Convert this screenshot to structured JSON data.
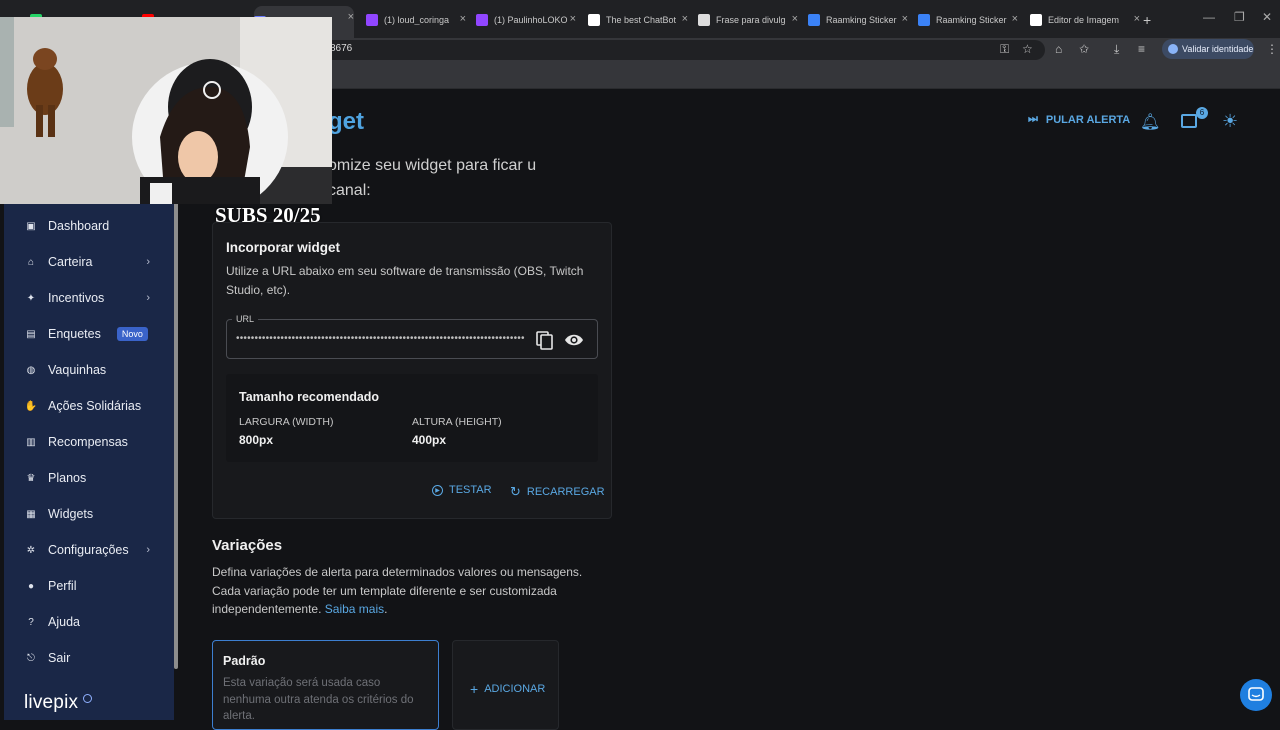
{
  "browser": {
    "tabs": [
      {
        "title": "",
        "favicon": "whatsapp-icon",
        "color": "#25d366",
        "closable": false
      },
      {
        "title": "",
        "favicon": "youtube-icon",
        "color": "#ff0000",
        "closable": false
      },
      {
        "title": "",
        "favicon": "livepix-icon",
        "color": "#6b7cff",
        "closable": true
      },
      {
        "title": "(1) loud_coringa",
        "favicon": "twitch-icon",
        "color": "#9146ff",
        "closable": true
      },
      {
        "title": "(1) PaulinhoLOKO",
        "favicon": "twitch-icon",
        "color": "#9146ff",
        "closable": true
      },
      {
        "title": "The best ChatBot",
        "favicon": "chatbot-icon",
        "color": "#ffffff",
        "closable": true
      },
      {
        "title": "Frase para divulg",
        "favicon": "openai-icon",
        "color": "#dddddd",
        "closable": true
      },
      {
        "title": "Raamking Sticker",
        "favicon": "gif-icon",
        "color": "#3b82f6",
        "closable": true
      },
      {
        "title": "Raamking Sticker",
        "favicon": "gif-icon",
        "color": "#3b82f6",
        "closable": true
      },
      {
        "title": "Editor de Imagem",
        "favicon": "photopea-icon",
        "color": "#ffffff",
        "closable": true
      }
    ],
    "new_tab": "+",
    "url_partial": "8676",
    "verify_label": "Validar identidade"
  },
  "overlay": {
    "subs_text": "SUBS 20/25"
  },
  "sidebar": {
    "items": [
      {
        "label": "Dashboard",
        "icon": "dashboard-icon",
        "glyph": "▣",
        "has_submenu": false
      },
      {
        "label": "Carteira",
        "icon": "bank-icon",
        "glyph": "⌂",
        "has_submenu": true
      },
      {
        "label": "Incentivos",
        "icon": "sparkle-icon",
        "glyph": "✦",
        "has_submenu": true
      },
      {
        "label": "Enquetes",
        "icon": "poll-icon",
        "glyph": "▤",
        "has_submenu": false,
        "badge": "Novo"
      },
      {
        "label": "Vaquinhas",
        "icon": "piggy-bank-icon",
        "glyph": "◍",
        "has_submenu": false
      },
      {
        "label": "Ações Solidárias",
        "icon": "hand-heart-icon",
        "glyph": "✋",
        "has_submenu": false
      },
      {
        "label": "Recompensas",
        "icon": "gift-icon",
        "glyph": "▥",
        "has_submenu": false
      },
      {
        "label": "Planos",
        "icon": "crown-icon",
        "glyph": "♛",
        "has_submenu": false
      },
      {
        "label": "Widgets",
        "icon": "widget-icon",
        "glyph": "▦",
        "has_submenu": false
      },
      {
        "label": "Configurações",
        "icon": "gear-icon",
        "glyph": "✲",
        "has_submenu": true
      },
      {
        "label": "Perfil",
        "icon": "user-icon",
        "glyph": "●",
        "has_submenu": false
      },
      {
        "label": "Ajuda",
        "icon": "help-icon",
        "glyph": "?",
        "has_submenu": false
      },
      {
        "label": "Sair",
        "icon": "logout-icon",
        "glyph": "⎋",
        "has_submenu": false
      }
    ],
    "logo": "livepix"
  },
  "header": {
    "title_partial": "get",
    "description": "omize seu widget para ficar u canal:",
    "skip_alert": "PULAR ALERTA",
    "notification_count": "6"
  },
  "embed": {
    "title": "Incorporar widget",
    "description": "Utilize a URL abaixo em seu software de transmissão (OBS, Twitch Studio, etc).",
    "url_label": "URL",
    "url_masked": "••••••••••••••••••••••••••••••••••••••••••••••••••••••••••••••••••••••••••••••",
    "recommended_title": "Tamanho recomendado",
    "width_label": "LARGURA (WIDTH)",
    "width_value": "800px",
    "height_label": "ALTURA (HEIGHT)",
    "height_value": "400px",
    "test_label": "TESTAR",
    "reload_label": "RECARREGAR"
  },
  "variations": {
    "title": "Variações",
    "description": "Defina variações de alerta para determinados valores ou mensagens. Cada variação pode ter um template diferente e ser customizada independentemente.",
    "learn_more": "Saiba mais",
    "learn_more_suffix": ".",
    "default_title": "Padrão",
    "default_desc": "Esta variação será usada caso nenhuma outra atenda os critérios do alerta.",
    "add_label": "ADICIONAR"
  },
  "colors": {
    "accent": "#5aa8e3",
    "sidebar_bg": "#1a2747",
    "page_bg": "#121316"
  }
}
